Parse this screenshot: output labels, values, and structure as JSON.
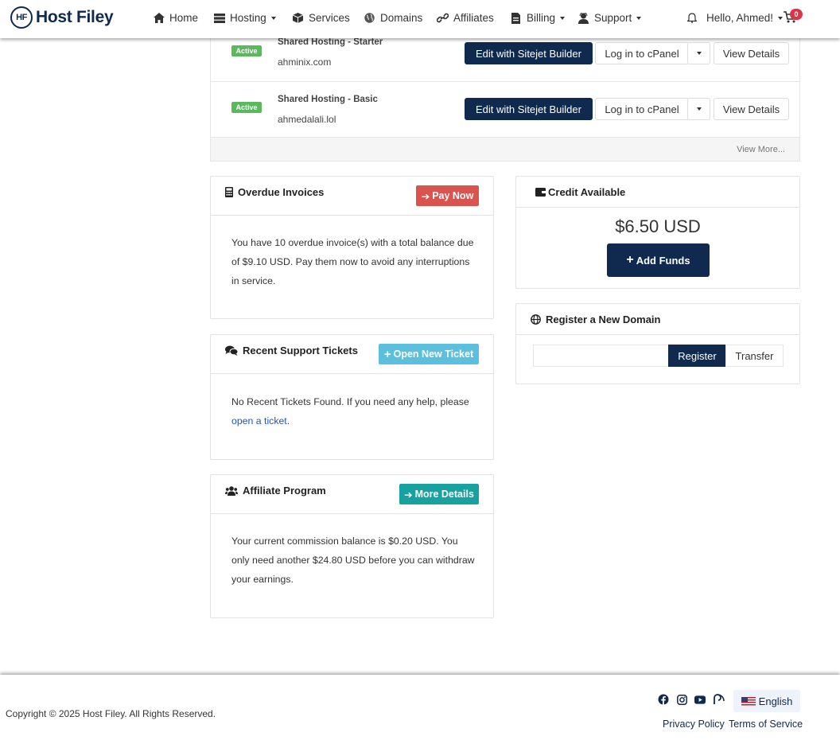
{
  "brand": {
    "logo_mark": "HF",
    "name": "Host Filey"
  },
  "nav": {
    "home": "Home",
    "hosting": "Hosting",
    "services": "Services",
    "domains": "Domains",
    "affiliates": "Affiliates",
    "billing": "Billing",
    "support": "Support",
    "user_greeting": "Hello, Ahmed!",
    "cart_count": "0"
  },
  "services": {
    "rows": [
      {
        "status": "Active",
        "name": "Shared Hosting - Starter",
        "domain": "ahminix.com"
      },
      {
        "status": "Active",
        "name": "Shared Hosting - Basic",
        "domain": "ahmedalali.lol"
      }
    ],
    "sitejet_label": "Edit with Sitejet Builder",
    "cpanel_label": "Log in to cPanel",
    "details_label": "View Details",
    "view_more": "View More..."
  },
  "overdue": {
    "title": "Overdue Invoices",
    "button": "Pay Now",
    "text": "You have 10 overdue invoice(s) with a total balance due of $9.10 USD. Pay them now to avoid any interruptions in service."
  },
  "tickets": {
    "title": "Recent Support Tickets",
    "button": "Open New Ticket",
    "text": "No Recent Tickets Found. If you need any help, please ",
    "link": "open a ticket",
    "suffix": "."
  },
  "affiliate": {
    "title": "Affiliate Program",
    "button": "More Details",
    "text": "Your current commission balance is $0.20 USD. You only need another $24.80 USD before you can withdraw your earnings."
  },
  "credit": {
    "title": "Credit Available",
    "amount": "$6.50 USD",
    "button": "Add Funds"
  },
  "register_domain": {
    "title": "Register a New Domain",
    "input_value": "",
    "register": "Register",
    "transfer": "Transfer"
  },
  "footer": {
    "copyright": "Copyright © 2025 Host Filey. All Rights Reserved.",
    "language": "English",
    "privacy": "Privacy Policy",
    "terms": "Terms of Service"
  },
  "colors": {
    "brand_navy": "#0f2a4e",
    "active_green": "#5cb85c",
    "danger_red": "#d9534f",
    "info_blue": "#5bc0de",
    "teal": "#17a2a0"
  },
  "icons": [
    "home-icon",
    "server-icon",
    "box-icon",
    "globe-icon",
    "link-icon",
    "invoice-icon",
    "support-agent-icon",
    "bell-icon",
    "cart-icon",
    "calculator-icon",
    "comments-icon",
    "users-icon",
    "wallet-icon",
    "facebook-icon",
    "instagram-icon",
    "youtube-icon",
    "blog-icon"
  ]
}
